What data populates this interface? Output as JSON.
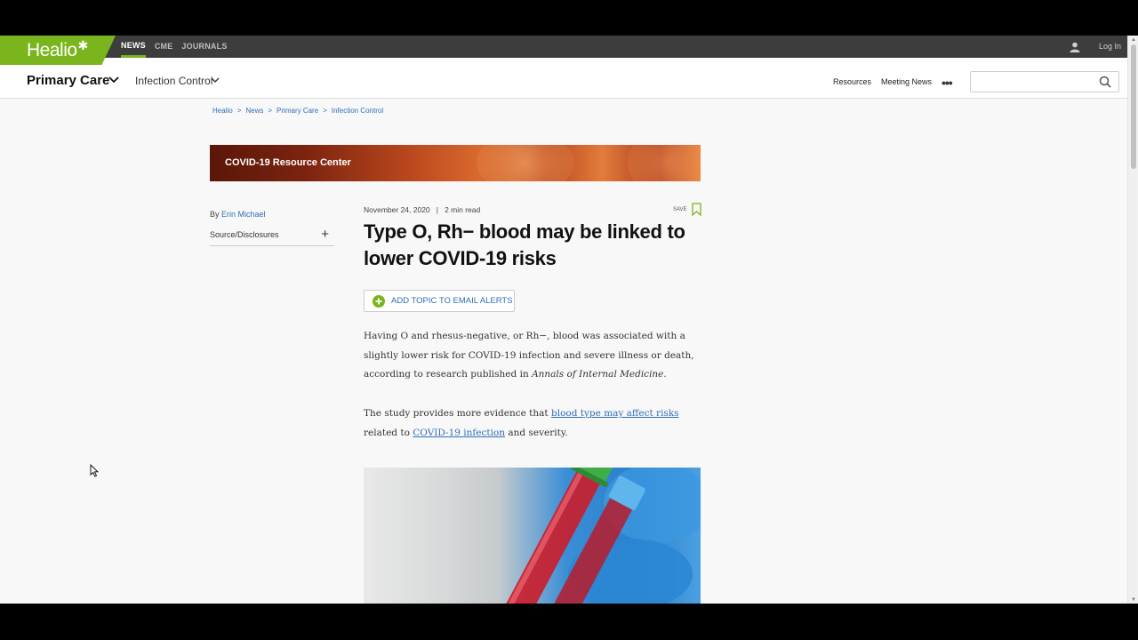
{
  "topbar": {
    "logo": "Healio",
    "nav": [
      "NEWS",
      "CME",
      "JOURNALS"
    ],
    "login": "Log In"
  },
  "secbar": {
    "section": "Primary Care",
    "subsection": "Infection Control",
    "links": [
      "Resources",
      "Meeting News"
    ],
    "more": "•••",
    "search_placeholder": ""
  },
  "breadcrumb": [
    "Healio",
    "News",
    "Primary Care",
    "Infection Control"
  ],
  "breadcrumb_sep": ">",
  "banner": "COVID-19 Resource Center",
  "byline": {
    "prefix": "By",
    "author": "Erin Michael",
    "disclosures": "Source/Disclosures",
    "plus": "+"
  },
  "article": {
    "date": "November 24, 2020",
    "sep": "|",
    "read_time": "2 min read",
    "save": "SAVE",
    "headline": "Type O, Rh− blood may be linked to lower COVID-19 risks",
    "alert_button": "ADD TOPIC TO EMAIL ALERTS",
    "p1_text": "Having O and rhesus-negative, or Rh−, blood was associated with a slightly lower risk for COVID-19 infection and severe illness or death, according to research published in",
    "p1_journal": "Annals of Internal Medicine",
    "p1_end": ".",
    "p2_a": "The study provides more evidence that",
    "p2_link1": "blood type may affect risks",
    "p2_b": "related to",
    "p2_link2": "COVID-19 infection",
    "p2_c": "and severity."
  },
  "colors": {
    "brand_green": "#7ab51d",
    "link_blue": "#2f6fb5",
    "topbar_bg": "#3d3d3d"
  }
}
